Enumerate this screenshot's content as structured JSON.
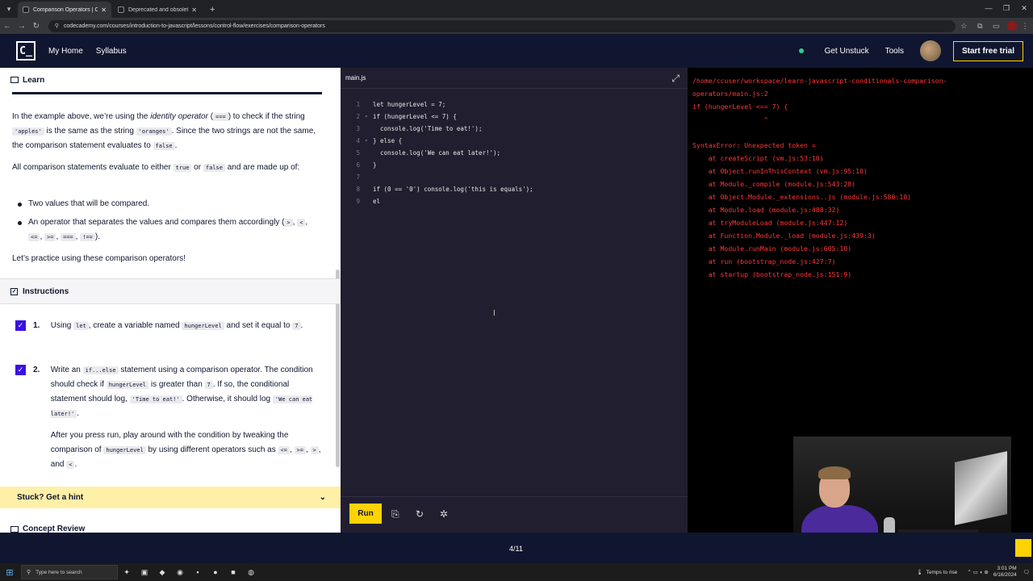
{
  "browser": {
    "tabs": [
      {
        "label": "Comparison Operators | Codecademy",
        "active": true
      },
      {
        "label": "Deprecated and obsolete features",
        "active": false
      }
    ],
    "url": "codecademy.com/courses/introduction-to-javascript/lessons/control-flow/exercises/comparison-operators"
  },
  "header": {
    "logo": "C_",
    "nav": [
      "My Home",
      "Syllabus"
    ],
    "get_unstuck": "Get Unstuck",
    "tools": "Tools",
    "trial_button": "Start free trial"
  },
  "learn": {
    "title": "Learn",
    "p1": {
      "a": "In the example above, we’re using the ",
      "em": "identity operator",
      "b": " (",
      "code1": "===",
      "c": ") to check if the string ",
      "code2": "'apples'",
      "d": " is the same as the string ",
      "code3": "'oranges'",
      "e": ". Since the two strings are not the same, the comparison statement evaluates to ",
      "code4": "false",
      "f": "."
    },
    "p2": {
      "a": "All comparison statements evaluate to either ",
      "code1": "true",
      "b": " or ",
      "code2": "false",
      "c": " and are made up of:"
    },
    "bullet1": "Two values that will be compared.",
    "bullet2": {
      "a": "An operator that separates the values and compares them accordingly (",
      "ops": [
        ">",
        "<",
        "<=",
        ">=",
        "===",
        "!=="
      ],
      "end": ")."
    },
    "p3": "Let’s practice using these comparison operators!"
  },
  "instructions": {
    "title": "Instructions",
    "task1": {
      "num": "1.",
      "a": "Using ",
      "code1": "let",
      "b": ", create a variable named ",
      "code2": "hungerLevel",
      "c": " and set it equal to ",
      "code3": "7",
      "d": "."
    },
    "task2": {
      "num": "2.",
      "a": "Write an ",
      "code1": "if...else",
      "b": " statement using a comparison operator. The condition should check if ",
      "code2": "hungerLevel",
      "c": " is greater than ",
      "code3": "7",
      "d": ". If so, the conditional statement should log, ",
      "code4": "'Time to eat!'",
      "e": ". Otherwise, it should log ",
      "code5": "'We can eat later!'",
      "f": ".",
      "g": "After you press run, play around with the condition by tweaking the comparison of ",
      "code6": "hungerLevel",
      "h": " by using different operators such as ",
      "code7": "<=",
      "code8": ">=",
      "code9": ">",
      "i": ", and ",
      "code10": "<",
      "j": "."
    },
    "hint": "Stuck? Get a hint",
    "concept_review": "Concept Review"
  },
  "editor": {
    "filename": "main.js",
    "lines": [
      {
        "n": "1",
        "fold": false,
        "text": "let hungerLevel = 7;"
      },
      {
        "n": "2",
        "fold": true,
        "text": "if (hungerLevel <= 7) {"
      },
      {
        "n": "3",
        "fold": false,
        "text": "  console.log('Time to eat!');"
      },
      {
        "n": "4",
        "fold": true,
        "text": "} else {"
      },
      {
        "n": "5",
        "fold": false,
        "text": "  console.log('We can eat later!');"
      },
      {
        "n": "6",
        "fold": false,
        "text": "}"
      },
      {
        "n": "7",
        "fold": false,
        "text": ""
      },
      {
        "n": "8",
        "fold": false,
        "text": "if (0 == '0') console.log('this is equals');"
      },
      {
        "n": "9",
        "fold": false,
        "text": "el"
      }
    ],
    "run_label": "Run"
  },
  "terminal": {
    "lines": [
      "/home/ccuser/workspace/learn-javascript-conditionals-comparison-",
      "operators/main.js:2",
      "if (hungerLevel <== 7) {",
      "                  ^",
      "",
      "SyntaxError: Unexpected token =",
      "    at createScript (vm.js:53:10)",
      "    at Object.runInThisContext (vm.js:95:10)",
      "    at Module._compile (module.js:543:28)",
      "    at Object.Module._extensions..js (module.js:580:10)",
      "    at Module.load (module.js:488:32)",
      "    at tryModuleLoad (module.js:447:12)",
      "    at Function.Module._load (module.js:439:3)",
      "    at Module.runMain (module.js:605:10)",
      "    at run (bootstrap_node.js:427:7)",
      "    at startup (bootstrap_node.js:151:9)"
    ]
  },
  "footer": {
    "progress": "4/11"
  },
  "taskbar": {
    "search_placeholder": "Type here to search",
    "weather": "Temps to rise",
    "time": "3:01 PM",
    "date": "6/16/2024"
  },
  "colors": {
    "accent": "#3a10e5",
    "brand_dark": "#10162f",
    "yellow": "#ffd300",
    "error": "#ff3838"
  }
}
